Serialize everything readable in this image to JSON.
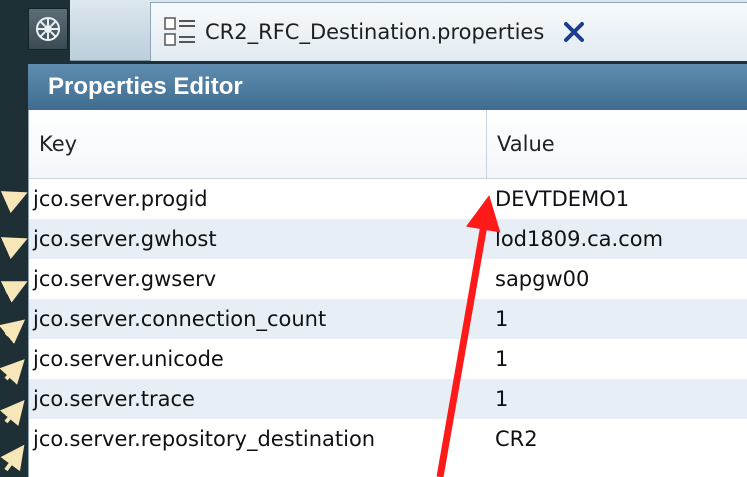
{
  "tab": {
    "title": "CR2_RFC_Destination.properties"
  },
  "editor": {
    "title": "Properties Editor"
  },
  "table": {
    "headers": {
      "key": "Key",
      "value": "Value"
    },
    "rows": [
      {
        "key": "jco.server.progid",
        "value": "DEVTDEMO1"
      },
      {
        "key": "jco.server.gwhost",
        "value": "lod1809.ca.com"
      },
      {
        "key": "jco.server.gwserv",
        "value": "sapgw00"
      },
      {
        "key": "jco.server.connection_count",
        "value": "1"
      },
      {
        "key": "jco.server.unicode",
        "value": "1"
      },
      {
        "key": "jco.server.trace",
        "value": "1"
      },
      {
        "key": "jco.server.repository_destination",
        "value": "CR2"
      }
    ]
  },
  "icons": {
    "app": "aperture-icon",
    "file": "properties-file-icon",
    "close": "close-icon"
  },
  "colors": {
    "annotation_arrow": "#ff1a1a",
    "pointer_arrows": "#f7e6b8",
    "header_bar": "#4a779a"
  }
}
